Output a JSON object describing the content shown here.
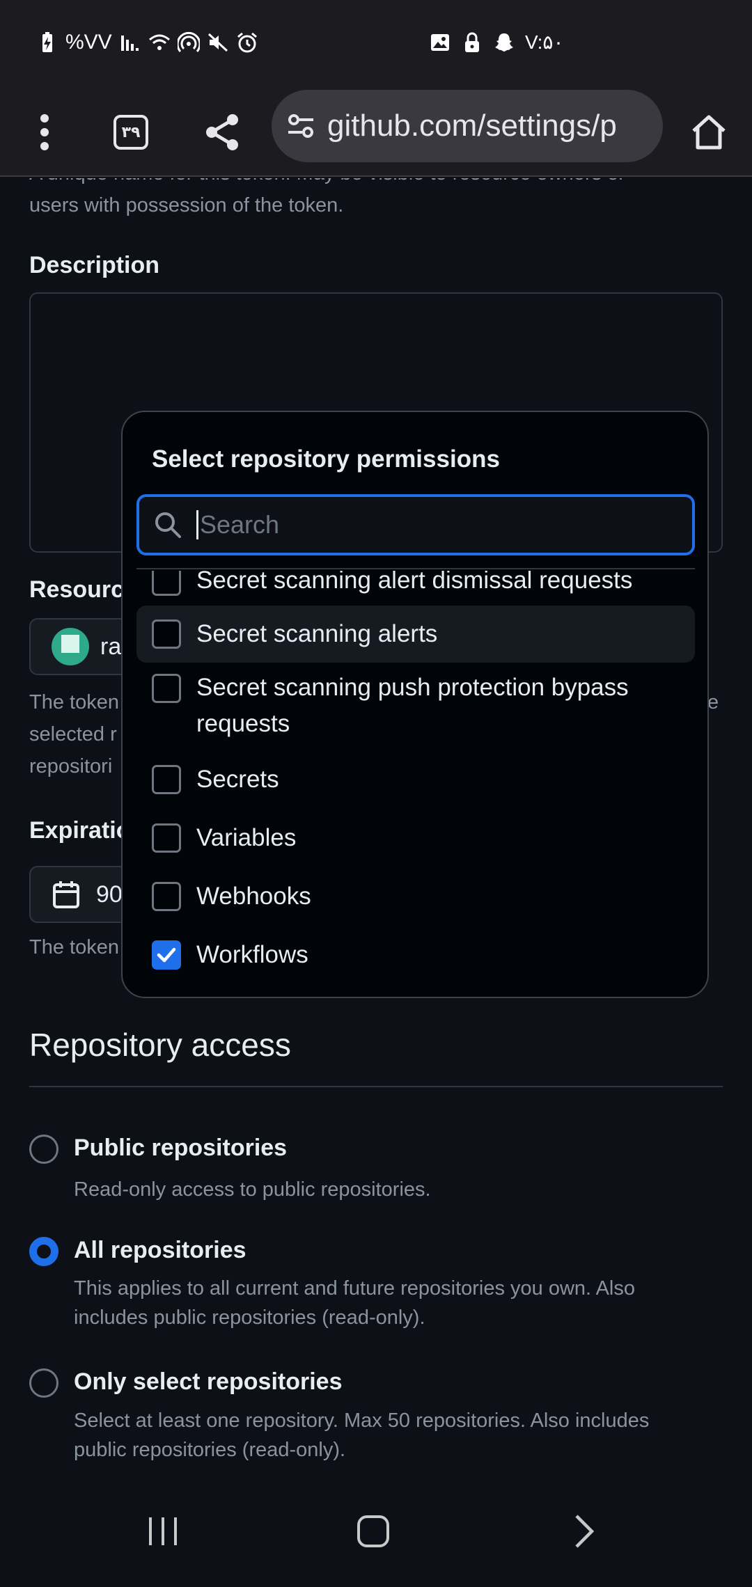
{
  "status_bar": {
    "left_text": "%VV",
    "time": "V:۵۰"
  },
  "browser": {
    "tab_count": "۳۹",
    "url": "github.com/settings/p"
  },
  "page": {
    "name_help": "A unique name for this token. May be visible to resource owners or users with possession of the token.",
    "name_help_line1": "A unique name for this token. May be visible to resource owners or",
    "name_help_line2": "users with possession of the token.",
    "description_label": "Description",
    "resource_label": "Resourc",
    "resource_chip": "ra",
    "resource_help_line1": "The token",
    "resource_help_line2": "selected r",
    "resource_help_line3": "repositori",
    "resource_help_tail": "e",
    "expiration_label": "Expiratio",
    "expiration_value": "90",
    "expiration_help": "The token",
    "repo_access_title": "Repository access",
    "options": [
      {
        "title": "Public repositories",
        "desc": "Read-only access to public repositories.",
        "selected": false
      },
      {
        "title": "All repositories",
        "desc": "This applies to all current and future repositories you own. Also includes public repositories (read-only).",
        "desc_line1": "This applies to all current and future repositories you own. Also",
        "desc_line2": "includes public repositories (read-only).",
        "selected": true
      },
      {
        "title": "Only select repositories",
        "desc_line1": "Select at least one repository. Max 50 repositories. Also includes",
        "desc_line2": "public repositories (read-only).",
        "selected": false
      }
    ]
  },
  "modal": {
    "title": "Select repository permissions",
    "search_placeholder": "Search",
    "items": [
      {
        "label": "Secret scanning alert dismissal requests",
        "checked": false
      },
      {
        "label": "Secret scanning alerts",
        "checked": false,
        "highlighted": true
      },
      {
        "label_line1": "Secret scanning push protection bypass",
        "label_line2": "requests",
        "checked": false
      },
      {
        "label": "Secrets",
        "checked": false
      },
      {
        "label": "Variables",
        "checked": false
      },
      {
        "label": "Webhooks",
        "checked": false
      },
      {
        "label": "Workflows",
        "checked": true
      }
    ]
  },
  "colors": {
    "accent": "#1f6feb",
    "background": "#0d1117",
    "modal_bg": "#010409"
  }
}
